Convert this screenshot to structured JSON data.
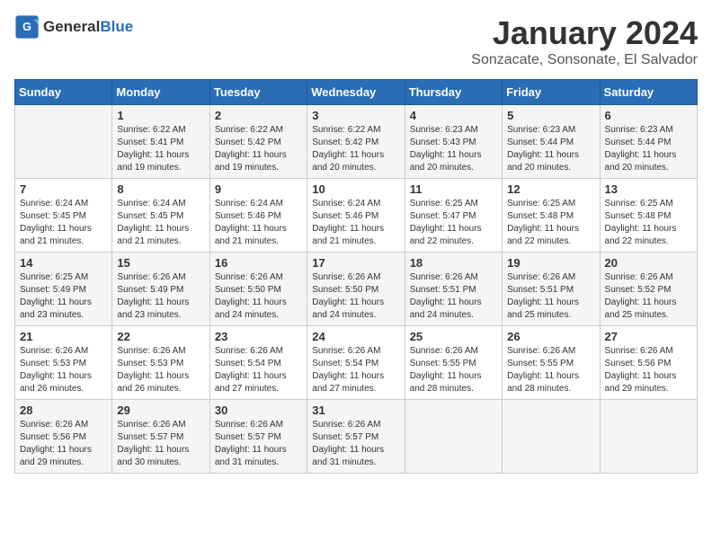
{
  "header": {
    "logo_general": "General",
    "logo_blue": "Blue",
    "month": "January 2024",
    "location": "Sonzacate, Sonsonate, El Salvador"
  },
  "days_of_week": [
    "Sunday",
    "Monday",
    "Tuesday",
    "Wednesday",
    "Thursday",
    "Friday",
    "Saturday"
  ],
  "weeks": [
    [
      {
        "day": "",
        "info": ""
      },
      {
        "day": "1",
        "info": "Sunrise: 6:22 AM\nSunset: 5:41 PM\nDaylight: 11 hours\nand 19 minutes."
      },
      {
        "day": "2",
        "info": "Sunrise: 6:22 AM\nSunset: 5:42 PM\nDaylight: 11 hours\nand 19 minutes."
      },
      {
        "day": "3",
        "info": "Sunrise: 6:22 AM\nSunset: 5:42 PM\nDaylight: 11 hours\nand 20 minutes."
      },
      {
        "day": "4",
        "info": "Sunrise: 6:23 AM\nSunset: 5:43 PM\nDaylight: 11 hours\nand 20 minutes."
      },
      {
        "day": "5",
        "info": "Sunrise: 6:23 AM\nSunset: 5:44 PM\nDaylight: 11 hours\nand 20 minutes."
      },
      {
        "day": "6",
        "info": "Sunrise: 6:23 AM\nSunset: 5:44 PM\nDaylight: 11 hours\nand 20 minutes."
      }
    ],
    [
      {
        "day": "7",
        "info": "Sunrise: 6:24 AM\nSunset: 5:45 PM\nDaylight: 11 hours\nand 21 minutes."
      },
      {
        "day": "8",
        "info": "Sunrise: 6:24 AM\nSunset: 5:45 PM\nDaylight: 11 hours\nand 21 minutes."
      },
      {
        "day": "9",
        "info": "Sunrise: 6:24 AM\nSunset: 5:46 PM\nDaylight: 11 hours\nand 21 minutes."
      },
      {
        "day": "10",
        "info": "Sunrise: 6:24 AM\nSunset: 5:46 PM\nDaylight: 11 hours\nand 21 minutes."
      },
      {
        "day": "11",
        "info": "Sunrise: 6:25 AM\nSunset: 5:47 PM\nDaylight: 11 hours\nand 22 minutes."
      },
      {
        "day": "12",
        "info": "Sunrise: 6:25 AM\nSunset: 5:48 PM\nDaylight: 11 hours\nand 22 minutes."
      },
      {
        "day": "13",
        "info": "Sunrise: 6:25 AM\nSunset: 5:48 PM\nDaylight: 11 hours\nand 22 minutes."
      }
    ],
    [
      {
        "day": "14",
        "info": "Sunrise: 6:25 AM\nSunset: 5:49 PM\nDaylight: 11 hours\nand 23 minutes."
      },
      {
        "day": "15",
        "info": "Sunrise: 6:26 AM\nSunset: 5:49 PM\nDaylight: 11 hours\nand 23 minutes."
      },
      {
        "day": "16",
        "info": "Sunrise: 6:26 AM\nSunset: 5:50 PM\nDaylight: 11 hours\nand 24 minutes."
      },
      {
        "day": "17",
        "info": "Sunrise: 6:26 AM\nSunset: 5:50 PM\nDaylight: 11 hours\nand 24 minutes."
      },
      {
        "day": "18",
        "info": "Sunrise: 6:26 AM\nSunset: 5:51 PM\nDaylight: 11 hours\nand 24 minutes."
      },
      {
        "day": "19",
        "info": "Sunrise: 6:26 AM\nSunset: 5:51 PM\nDaylight: 11 hours\nand 25 minutes."
      },
      {
        "day": "20",
        "info": "Sunrise: 6:26 AM\nSunset: 5:52 PM\nDaylight: 11 hours\nand 25 minutes."
      }
    ],
    [
      {
        "day": "21",
        "info": "Sunrise: 6:26 AM\nSunset: 5:53 PM\nDaylight: 11 hours\nand 26 minutes."
      },
      {
        "day": "22",
        "info": "Sunrise: 6:26 AM\nSunset: 5:53 PM\nDaylight: 11 hours\nand 26 minutes."
      },
      {
        "day": "23",
        "info": "Sunrise: 6:26 AM\nSunset: 5:54 PM\nDaylight: 11 hours\nand 27 minutes."
      },
      {
        "day": "24",
        "info": "Sunrise: 6:26 AM\nSunset: 5:54 PM\nDaylight: 11 hours\nand 27 minutes."
      },
      {
        "day": "25",
        "info": "Sunrise: 6:26 AM\nSunset: 5:55 PM\nDaylight: 11 hours\nand 28 minutes."
      },
      {
        "day": "26",
        "info": "Sunrise: 6:26 AM\nSunset: 5:55 PM\nDaylight: 11 hours\nand 28 minutes."
      },
      {
        "day": "27",
        "info": "Sunrise: 6:26 AM\nSunset: 5:56 PM\nDaylight: 11 hours\nand 29 minutes."
      }
    ],
    [
      {
        "day": "28",
        "info": "Sunrise: 6:26 AM\nSunset: 5:56 PM\nDaylight: 11 hours\nand 29 minutes."
      },
      {
        "day": "29",
        "info": "Sunrise: 6:26 AM\nSunset: 5:57 PM\nDaylight: 11 hours\nand 30 minutes."
      },
      {
        "day": "30",
        "info": "Sunrise: 6:26 AM\nSunset: 5:57 PM\nDaylight: 11 hours\nand 31 minutes."
      },
      {
        "day": "31",
        "info": "Sunrise: 6:26 AM\nSunset: 5:57 PM\nDaylight: 11 hours\nand 31 minutes."
      },
      {
        "day": "",
        "info": ""
      },
      {
        "day": "",
        "info": ""
      },
      {
        "day": "",
        "info": ""
      }
    ]
  ]
}
